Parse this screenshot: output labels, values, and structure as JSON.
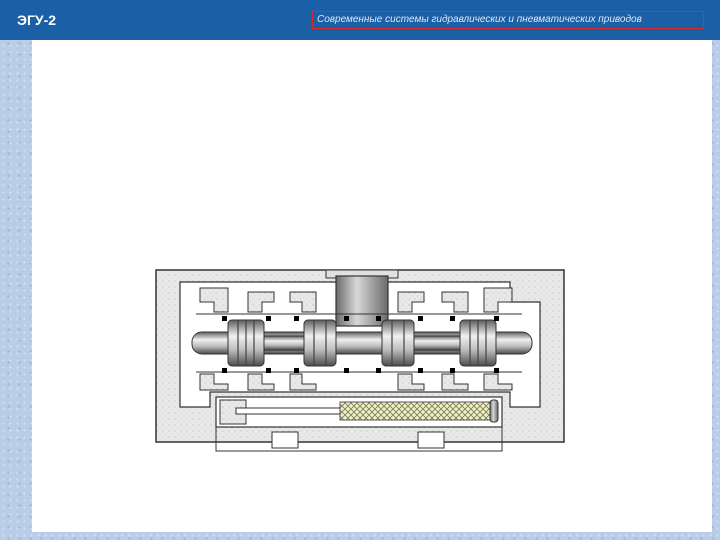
{
  "header": {
    "slide_id": "ЭГУ-2",
    "course_title": "Современные системы гидравлических и пневматических приводов"
  },
  "colors": {
    "header_blue": "#1b5fa6",
    "title_frame": "#d8282a",
    "body_gray": "#e6e6e6",
    "spool_gray": "#9c9c9c",
    "seal_black": "#000000",
    "filter_mesh": "#cfcf9a"
  },
  "diagram": {
    "subject": "spool-valve-cross-section"
  }
}
